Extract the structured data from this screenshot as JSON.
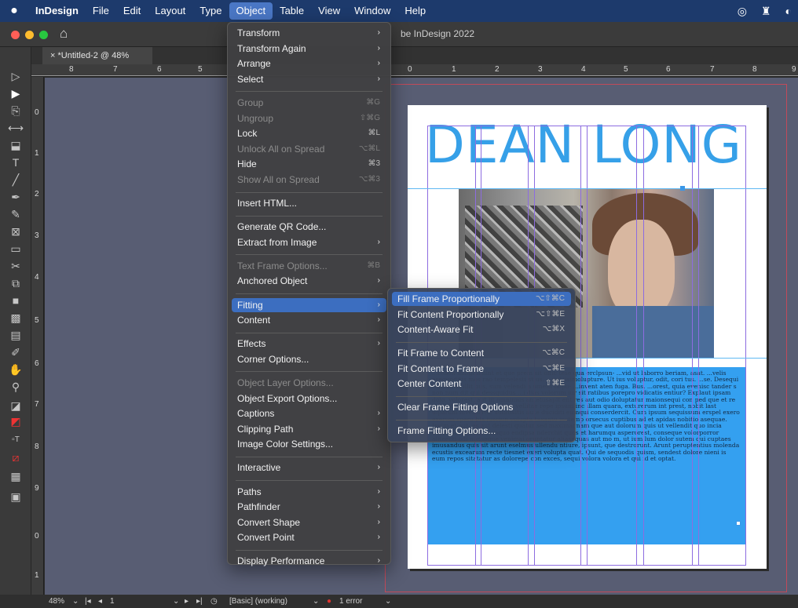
{
  "menubar": {
    "apple": "",
    "items": [
      "InDesign",
      "File",
      "Edit",
      "Layout",
      "Type",
      "Object",
      "Table",
      "View",
      "Window",
      "Help"
    ]
  },
  "window": {
    "title": "be InDesign 2022"
  },
  "doc_tab": {
    "label": "× *Untitled-2 @ 48%"
  },
  "hruler": [
    {
      "label": "8"
    },
    {
      "label": "7"
    },
    {
      "label": "6"
    },
    {
      "label": "5"
    },
    {
      "label": "0"
    },
    {
      "label": "1"
    },
    {
      "label": "2"
    },
    {
      "label": "3"
    },
    {
      "label": "4"
    },
    {
      "label": "5"
    },
    {
      "label": "6"
    },
    {
      "label": "7"
    },
    {
      "label": "8"
    },
    {
      "label": "9"
    }
  ],
  "vruler": [
    "0",
    "1",
    "2",
    "3",
    "4",
    "5",
    "6",
    "7",
    "8",
    "9",
    "0",
    "1"
  ],
  "page": {
    "headline": "DEAN LONG",
    "body_text": "...rehen inlliginimint et que prem sit offic tese qua erclpsun- ...vid ut laborro beriam, asat. ...velis esequoditis mos rao tempelesti stius. ...pel iisimolupture. Ut ius voluptur, odit, cori tus. ...se. Desequi sendantis illit bus, sum velendi a ument impo- ...invent aten fuga. Bus. ...orest, quia evenisc tander s non num dit qui dessquidus ...i dias volorum iur sit ratibus porepro vidicatis entiur? Explaut ipsam dolo, volorest, aut lit omnimus antetusapit ent res aut odio doluptatur maionsequi con ped que et re vel initia dictuptium volore vellitae repe ipsum inc illam quara, exturerum int prest, nobit last ulparum inventiatur sutatisitis aute duciditi eumqui conserdercit. Cum ipsum sequissum erspel exero exerum spero bla iusciun volupta taxanto inctemp orsecus cuptibus ad et apidas nobitio asequae. Ipsim et aut, es aut delesti quatur sed maximagnam que aut dolorum quis ut vellendit quo incia dolorest, es cone eumquo endipsa nderchit quos et harumqu asperorest, conseque volorporror aliteecti odi nonseque venimai oruptatur aliasequas aut mo m, ut ium lum dolor sutem qui cuptaes imusandus quis sit arunt eselmus ullendu ntiure, ipsunt, que destrorunt. Arunt peruptentius molenda ecustis excearum recte tiesnet exeri volupta quat. Qui de sequodis quism, sendest dolore nieni is eum repos sitatatur as dolorepe con exces, sequi volora volora et qui id et optat."
  },
  "object_menu": {
    "items": [
      {
        "label": "Transform",
        "shortcut": "",
        "submenu": true,
        "disabled": false
      },
      {
        "label": "Transform Again",
        "shortcut": "",
        "submenu": true,
        "disabled": false
      },
      {
        "label": "Arrange",
        "shortcut": "",
        "submenu": true,
        "disabled": false
      },
      {
        "label": "Select",
        "shortcut": "",
        "submenu": true,
        "disabled": false
      },
      {
        "sep": true
      },
      {
        "label": "Group",
        "shortcut": "⌘G",
        "submenu": false,
        "disabled": true
      },
      {
        "label": "Ungroup",
        "shortcut": "⇧⌘G",
        "submenu": false,
        "disabled": true
      },
      {
        "label": "Lock",
        "shortcut": "⌘L",
        "submenu": false,
        "disabled": false
      },
      {
        "label": "Unlock All on Spread",
        "shortcut": "⌥⌘L",
        "submenu": false,
        "disabled": true
      },
      {
        "label": "Hide",
        "shortcut": "⌘3",
        "submenu": false,
        "disabled": false
      },
      {
        "label": "Show All on Spread",
        "shortcut": "⌥⌘3",
        "submenu": false,
        "disabled": true
      },
      {
        "sep": true
      },
      {
        "label": "Insert HTML...",
        "shortcut": "",
        "submenu": false,
        "disabled": false
      },
      {
        "sep": true
      },
      {
        "label": "Generate QR Code...",
        "shortcut": "",
        "submenu": false,
        "disabled": false
      },
      {
        "label": "Extract from Image",
        "shortcut": "",
        "submenu": true,
        "disabled": false
      },
      {
        "sep": true
      },
      {
        "label": "Text Frame Options...",
        "shortcut": "⌘B",
        "submenu": false,
        "disabled": true
      },
      {
        "label": "Anchored Object",
        "shortcut": "",
        "submenu": true,
        "disabled": false
      },
      {
        "sep": true
      },
      {
        "label": "Fitting",
        "shortcut": "",
        "submenu": true,
        "disabled": false,
        "highlighted": true
      },
      {
        "label": "Content",
        "shortcut": "",
        "submenu": true,
        "disabled": false
      },
      {
        "sep": true
      },
      {
        "label": "Effects",
        "shortcut": "",
        "submenu": true,
        "disabled": false
      },
      {
        "label": "Corner Options...",
        "shortcut": "",
        "submenu": false,
        "disabled": false
      },
      {
        "sep": true
      },
      {
        "label": "Object Layer Options...",
        "shortcut": "",
        "submenu": false,
        "disabled": true
      },
      {
        "label": "Object Export Options...",
        "shortcut": "",
        "submenu": false,
        "disabled": false
      },
      {
        "label": "Captions",
        "shortcut": "",
        "submenu": true,
        "disabled": false
      },
      {
        "label": "Clipping Path",
        "shortcut": "",
        "submenu": true,
        "disabled": false
      },
      {
        "label": "Image Color Settings...",
        "shortcut": "",
        "submenu": false,
        "disabled": false
      },
      {
        "sep": true
      },
      {
        "label": "Interactive",
        "shortcut": "",
        "submenu": true,
        "disabled": false
      },
      {
        "sep": true
      },
      {
        "label": "Paths",
        "shortcut": "",
        "submenu": true,
        "disabled": false
      },
      {
        "label": "Pathfinder",
        "shortcut": "",
        "submenu": true,
        "disabled": false
      },
      {
        "label": "Convert Shape",
        "shortcut": "",
        "submenu": true,
        "disabled": false
      },
      {
        "label": "Convert Point",
        "shortcut": "",
        "submenu": true,
        "disabled": false
      },
      {
        "sep": true
      },
      {
        "label": "Display Performance",
        "shortcut": "",
        "submenu": true,
        "disabled": false
      }
    ]
  },
  "fitting_menu": {
    "items": [
      {
        "label": "Fill Frame Proportionally",
        "shortcut": "⌥⇧⌘C",
        "highlighted": true
      },
      {
        "label": "Fit Content Proportionally",
        "shortcut": "⌥⇧⌘E"
      },
      {
        "label": "Content-Aware Fit",
        "shortcut": "⌥⌘X"
      },
      {
        "sep": true
      },
      {
        "label": "Fit Frame to Content",
        "shortcut": "⌥⌘C"
      },
      {
        "label": "Fit Content to Frame",
        "shortcut": "⌥⌘E"
      },
      {
        "label": "Center Content",
        "shortcut": "⇧⌘E"
      },
      {
        "sep": true
      },
      {
        "label": "Clear Frame Fitting Options",
        "shortcut": ""
      },
      {
        "sep": true
      },
      {
        "label": "Frame Fitting Options...",
        "shortcut": ""
      }
    ]
  },
  "statusbar": {
    "zoom": "48%",
    "page": "1",
    "preflight_profile": "[Basic] (working)",
    "errors": "1 error"
  },
  "colors": {
    "accent": "#36a0e8",
    "menu_highlight": "#3c6ec0",
    "error": "#e0332f"
  }
}
